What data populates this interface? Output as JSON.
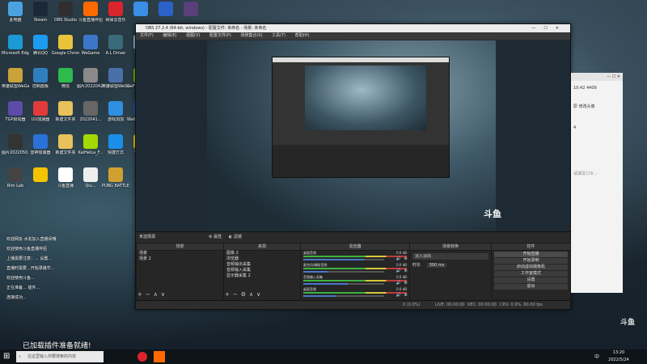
{
  "desktop": {
    "icons": [
      {
        "label": "此电脑",
        "color": "#4aa3e0"
      },
      {
        "label": "Steam",
        "color": "#1b2838"
      },
      {
        "label": "OBS Studio",
        "color": "#302e31"
      },
      {
        "label": "斗鱼直播伴侣",
        "color": "#ff6a00"
      },
      {
        "label": "网易云音乐",
        "color": "#d9252b"
      },
      {
        "label": "",
        "color": "#3a8ee6"
      },
      {
        "label": "",
        "color": "#2b62c9"
      },
      {
        "label": "",
        "color": "#5a3f7a"
      },
      {
        "label": "Microsoft Edge",
        "color": "#1b9ad6"
      },
      {
        "label": "腾讯QQ",
        "color": "#1d9bf0"
      },
      {
        "label": "Google Chrome",
        "color": "#e9c43a"
      },
      {
        "label": "WeGame",
        "color": "#3c76c9"
      },
      {
        "label": "A.L Driver",
        "color": "#3a6b7a"
      },
      {
        "label": "回收站",
        "color": "#8fb7d8"
      },
      {
        "label": "QQ",
        "color": "#111111"
      },
      {
        "label": "新建文本文档",
        "color": "#eeeeee"
      },
      {
        "label": "英雄联盟WeGame版",
        "color": "#c9a23a"
      },
      {
        "label": "控制面板",
        "color": "#2f7fbf"
      },
      {
        "label": "微信",
        "color": "#2dbb4e"
      },
      {
        "label": "图片2022042...",
        "color": "#8a8a8a"
      },
      {
        "label": "英雄联盟WeGame版",
        "color": "#4a6fa8"
      },
      {
        "label": "GeForce Experience",
        "color": "#76b900"
      },
      {
        "label": "有道翻译",
        "color": "#e33b3b"
      },
      {
        "label": "2022041...",
        "color": "#555555"
      },
      {
        "label": "TGP启动器",
        "color": "#5e4aa8"
      },
      {
        "label": "UU加速器",
        "color": "#e23b3b"
      },
      {
        "label": "新建文件夹",
        "color": "#e8c15a"
      },
      {
        "label": "2022041...",
        "color": "#666666"
      },
      {
        "label": "游戏加加",
        "color": "#2f8fe0"
      },
      {
        "label": "Wallpaper Engine",
        "color": "#1d4fa8"
      },
      {
        "label": "迅雷",
        "color": "#2aa7ea"
      },
      {
        "label": "2022041...",
        "color": "#555555"
      },
      {
        "label": "图片2022050...",
        "color": "#333333"
      },
      {
        "label": "雷神加速器",
        "color": "#2a72d8"
      },
      {
        "label": "新建文件夹",
        "color": "#e8c15a"
      },
      {
        "label": "KaiHeiLa_F...",
        "color": "#a3d900"
      },
      {
        "label": "快捷方式",
        "color": "#1a8ee8"
      },
      {
        "label": "YY语音",
        "color": "#f0c800"
      },
      {
        "label": "图片2022050...",
        "color": "#444444"
      },
      {
        "label": "UU加速器",
        "color": "#d03a8a"
      },
      {
        "label": "Rim Lab",
        "color": "#444444"
      },
      {
        "label": "",
        "color": "#f4c400"
      },
      {
        "label": "斗鱼直播",
        "color": "#ffffff"
      },
      {
        "label": "Qiu...",
        "color": "#eeeeee"
      },
      {
        "label": "PUBG BATTLEGR...",
        "color": "#d0a030"
      }
    ],
    "chat_lines": [
      "欢迎网友·水友加入直播间哦",
      "欢迎使用斗鱼直播伴侣",
      "上播需要注意：... 设置...",
      "直播时需要...开始录播节...",
      "欢迎使用斗鱼...",
      "正在准备... 插件...",
      "连接成功..."
    ],
    "toast": "已加载插件准备就绪!",
    "watermark": "斗鱼"
  },
  "obs": {
    "title": "OBS 27.2.4 (64-bit, windows) - 配置文件: 未命名 - 场景: 未命名",
    "window_controls": [
      "—",
      "☐",
      "✕"
    ],
    "menu": [
      "文件(F)",
      "编辑(E)",
      "视图(V)",
      "配置文件(P)",
      "场景集合(S)",
      "工具(T)",
      "帮助(H)"
    ],
    "scene_bar": {
      "label": "未选择源",
      "properties": "属性",
      "filters": "滤镜"
    },
    "docks": {
      "scenes": {
        "title": "场景",
        "items": [
          "场景",
          "场景 2"
        ]
      },
      "sources": {
        "title": "来源",
        "items": [
          "图像 2",
          "浏览器",
          "音频输出采集",
          "音频输入采集",
          "显示器采集 2"
        ]
      },
      "mixer": {
        "title": "混音器",
        "tracks": [
          {
            "name": "桌面音频",
            "db": "0.0 dB",
            "level": 0.75
          },
          {
            "name": "麦克风/辅助音频",
            "db": "0.0 dB",
            "level": 0.3
          },
          {
            "name": "音频输入采集",
            "db": "0.0 dB",
            "level": 0.55
          },
          {
            "name": "桌面音频",
            "db": "0.0 dB",
            "level": 0.4
          }
        ]
      },
      "transitions": {
        "title": "场景转换",
        "type": "淡入淡出",
        "duration_label": "时长",
        "duration": "300 ms"
      },
      "controls": {
        "title": "控件",
        "buttons": [
          "开始直播",
          "开始录制",
          "启动虚拟摄像机",
          "工作室模式",
          "设置",
          "退出"
        ]
      }
    },
    "status": {
      "dropped": "0 (0.0%)",
      "live": "LIVE: 00:00:00",
      "rec": "REC: 00:00:00",
      "cpu": "CPU: 0.9%, 60.00 fps"
    },
    "bottom_buttons": [
      "+",
      "−",
      "⚙",
      "∧",
      "∨"
    ]
  },
  "side_app": {
    "labels": [
      "10:42 4409",
      "原 修改头像",
      "4",
      "请填写口令..."
    ]
  },
  "taskbar": {
    "search_placeholder": "在这里输入你要搜索的内容",
    "time": "13:20",
    "date": "2022/5/24",
    "lang": "中"
  }
}
